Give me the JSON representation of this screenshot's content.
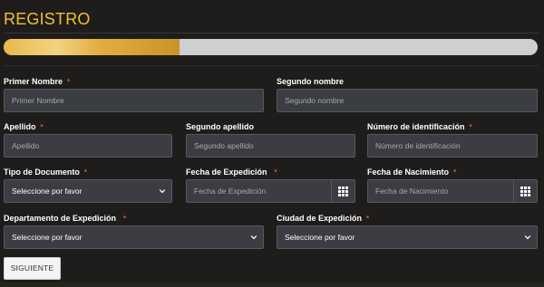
{
  "title": "REGISTRO",
  "progress": {
    "value_percent": 33
  },
  "colors": {
    "accent": "#f1c232",
    "background": "#1f1d1c",
    "required": "#d9534f"
  },
  "fields": {
    "primer_nombre": {
      "label": "Primer Nombre",
      "required": "*",
      "placeholder": "Primer Nombre"
    },
    "segundo_nombre": {
      "label": "Segundo nombre",
      "placeholder": "Segundo nombre"
    },
    "apellido": {
      "label": "Apellido",
      "required": "*",
      "placeholder": "Apellido"
    },
    "segundo_apellido": {
      "label": "Segundo apellido",
      "placeholder": "Segundo apellido"
    },
    "numero_identificacion": {
      "label": "Número de identificación",
      "required": "*",
      "placeholder": "Número de identificación"
    },
    "tipo_documento": {
      "label": "Tipo de Documento",
      "required": "*",
      "value": "Seleccione por favor"
    },
    "fecha_expedicion": {
      "label": "Fecha de Expedición",
      "required": "*",
      "placeholder": "Fecha de Expedición"
    },
    "fecha_nacimiento": {
      "label": "Fecha de Nacimiento",
      "required": "*",
      "placeholder": "Fecha de Nacimiento"
    },
    "departamento_expedicion": {
      "label": "Departamento de Expedición",
      "required": "*",
      "value": "Seleccione por favor"
    },
    "ciudad_expedicion": {
      "label": "Ciudad de Expedición",
      "required": "*",
      "value": "Seleccione por favor"
    }
  },
  "icons": {
    "calendar": "calendar-icon",
    "select": "chevron-down-icon"
  },
  "buttons": {
    "next": "SIGUIENTE"
  }
}
